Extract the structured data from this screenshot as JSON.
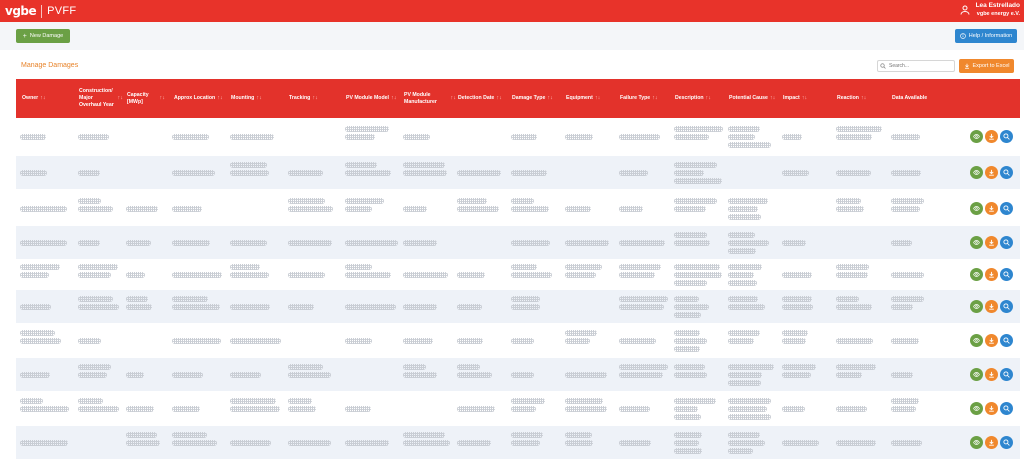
{
  "header": {
    "logo_text": "vgbe",
    "app_title": "PVFF",
    "user_name": "Lea Estrellado",
    "user_org": "vgbe energy e.V."
  },
  "toolbar": {
    "new_label": "New Damage",
    "help_label": "Help / Information"
  },
  "panel": {
    "title": "Manage Damages",
    "search_placeholder": "Search...",
    "export_label": "Export to Excel"
  },
  "columns": [
    {
      "label": "Owner",
      "sortable": true
    },
    {
      "label": "Construction/ Major Overhaul Year",
      "sortable": true
    },
    {
      "label": "Capacity [MWp]",
      "sortable": true
    },
    {
      "label": "Approx Location",
      "sortable": true
    },
    {
      "label": "Mounting",
      "sortable": true
    },
    {
      "label": "Tracking",
      "sortable": true
    },
    {
      "label": "PV Module Model",
      "sortable": true
    },
    {
      "label": "PV Module Manufacturer",
      "sortable": true
    },
    {
      "label": "Detection Date",
      "sortable": true
    },
    {
      "label": "Damage Type",
      "sortable": true
    },
    {
      "label": "Equipment",
      "sortable": true
    },
    {
      "label": "Failure Type",
      "sortable": true
    },
    {
      "label": "Description",
      "sortable": true
    },
    {
      "label": "Potential Cause",
      "sortable": true
    },
    {
      "label": "Impact",
      "sortable": true
    },
    {
      "label": "Reaction",
      "sortable": true
    },
    {
      "label": "Data Available",
      "sortable": false
    }
  ],
  "icons": {
    "new": "plus-icon",
    "help": "info-icon",
    "user": "user-icon",
    "search": "search-icon",
    "export": "download-icon",
    "row_actions": [
      "eye-icon",
      "download-icon",
      "search-icon"
    ]
  },
  "colors": {
    "brand_red": "#e8332a",
    "green": "#6ba045",
    "blue": "#2e86cf",
    "orange": "#f0882d",
    "title_orange": "#e8842b"
  },
  "row_count": 10,
  "cell_content": "redacted"
}
